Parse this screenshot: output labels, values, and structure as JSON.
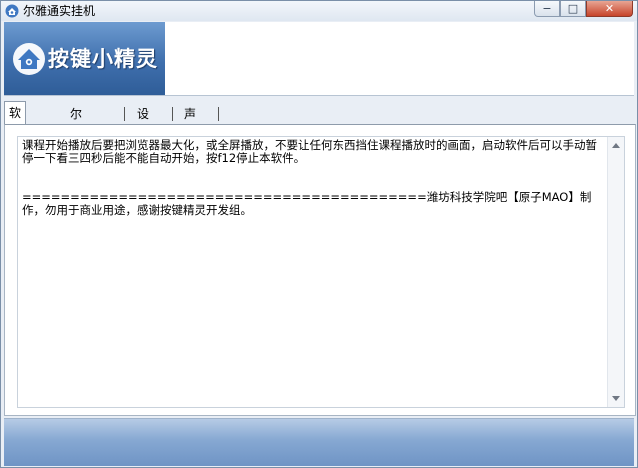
{
  "window": {
    "title": "尔雅通实挂机",
    "min_label": "−",
    "max_label": "□",
    "close_label": "✕"
  },
  "banner": {
    "logo_text": "按键小精灵"
  },
  "tabs": [
    {
      "label": "软件说明"
    },
    {
      "label": "尔雅同时"
    },
    {
      "label": "设置"
    },
    {
      "label": "声明"
    }
  ],
  "content": {
    "text": "课程开始播放后要把浏览器最大化，或全屏播放，不要让任何东西挡住课程播放时的画面，启动软件后可以手动暂停一下看三四秒后能不能自动开始，按f12停止本软件。\n\n\n==========================================潍坊科技学院吧【原子MAO】制作，勿用于商业用途，感谢按键精灵开发组。"
  },
  "colors": {
    "accent": "#3f6fad",
    "close": "#c7442a"
  }
}
